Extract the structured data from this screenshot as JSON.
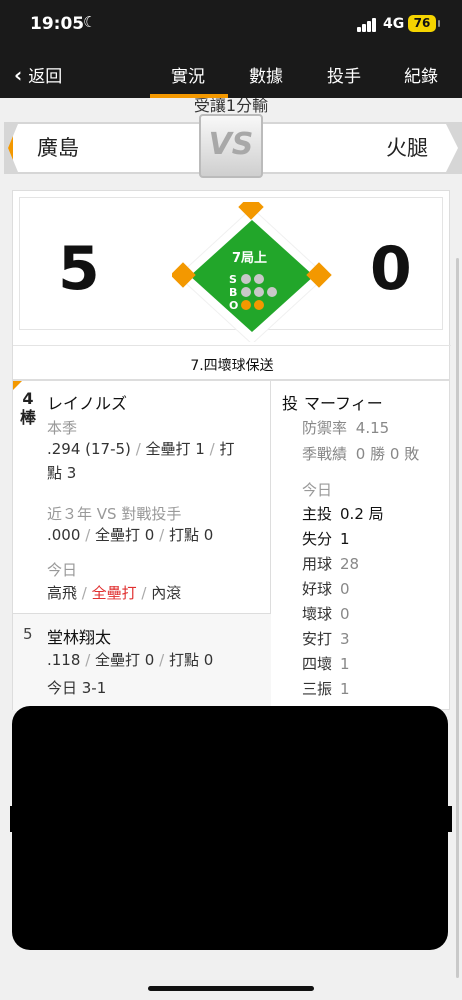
{
  "status": {
    "time": "19:05",
    "network": "4G",
    "battery": "76"
  },
  "nav": {
    "back_label": "返回",
    "tabs": [
      {
        "label": "實況",
        "active": true
      },
      {
        "label": "數據",
        "active": false
      },
      {
        "label": "投手",
        "active": false
      },
      {
        "label": "紀錄",
        "active": false
      }
    ]
  },
  "game": {
    "clipped_text": "受讓1分輸",
    "home_team": "廣島",
    "away_team": "火腿",
    "vs": "VS",
    "score_home": "5",
    "score_away": "0",
    "inning": "7局上",
    "count": {
      "s_label": "S",
      "b_label": "B",
      "o_label": "O",
      "strikes": 0,
      "balls": 0,
      "outs": 2
    },
    "result": "7.四壞球保送",
    "accent_color": "#f39800",
    "field_color": "#22a62a"
  },
  "batter": {
    "order": "4",
    "order_suffix": "棒",
    "name": "レイノルズ",
    "season_label": "本季",
    "season_avg": ".294 (17-5)",
    "season_hr": "全壘打 1",
    "season_rbi_label": "打",
    "season_rbi": "點 3",
    "vs_label": "近３年 VS 對戰投手",
    "vs_avg": ".000",
    "vs_hr": "全壘打 0",
    "vs_rbi": "打點 0",
    "today_label": "今日",
    "today_1": "高飛",
    "today_2": "全壘打",
    "today_3": "內滾"
  },
  "next_batter": {
    "order": "5",
    "name": "堂林翔太",
    "avg": ".118",
    "hr": "全壘打 0",
    "rbi": "打點 0",
    "today": "今日 3-1"
  },
  "pitcher": {
    "role": "投",
    "name": "マーフィー",
    "era_label": "防禦率",
    "era": "4.15",
    "record_label": "季戰績",
    "record": "0 勝 0 敗",
    "today_label": "今日",
    "stats": [
      {
        "k": "主投",
        "v": "0.2 局",
        "strong": true
      },
      {
        "k": "失分",
        "v": "1",
        "strong": true
      },
      {
        "k": "用球",
        "v": "28",
        "strong": false
      },
      {
        "k": "好球",
        "v": "0",
        "strong": false
      },
      {
        "k": "壞球",
        "v": "0",
        "strong": false
      },
      {
        "k": "安打",
        "v": "3",
        "strong": false
      },
      {
        "k": "四壞",
        "v": "1",
        "strong": false
      },
      {
        "k": "三振",
        "v": "1",
        "strong": false
      }
    ]
  }
}
